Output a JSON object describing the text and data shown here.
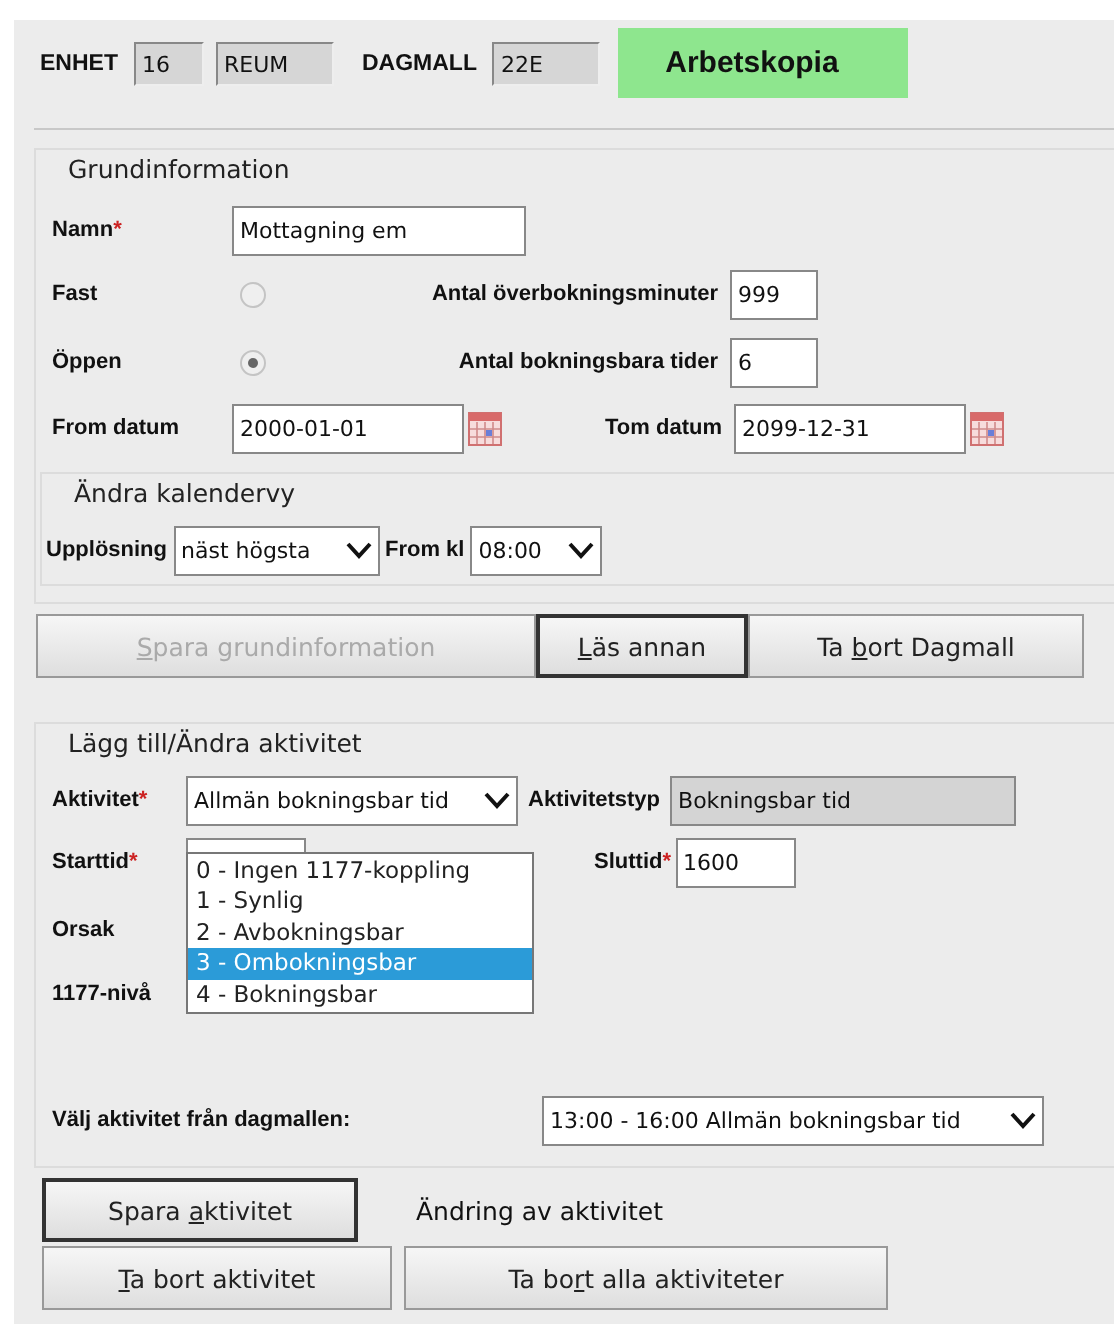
{
  "header": {
    "fields": [
      {
        "label": "ENHET",
        "values": [
          "16",
          "REUM"
        ]
      },
      {
        "label": "DAGMALL",
        "values": [
          "22E"
        ]
      }
    ],
    "status": "Arbetskopia"
  },
  "grundinformation": {
    "legend": "Grundinformation",
    "name": {
      "label": "Namn",
      "mark": "*",
      "value": "Mottagning em"
    },
    "radios": [
      {
        "label": "Fast",
        "selected": false,
        "count_label": "Antal överbokningsminuter",
        "count_value": "999"
      },
      {
        "label": "Öppen",
        "selected": true,
        "count_label": "Antal bokningsbara tider",
        "count_value": "6"
      }
    ],
    "dates": [
      {
        "label": "From datum",
        "value": "2000-01-01"
      },
      {
        "label": "Tom datum",
        "value": "2099-12-31"
      }
    ],
    "calendar_view": {
      "legend": "Ändra kalendervy",
      "selects": [
        {
          "label": "Upplösning",
          "value": "näst högsta"
        },
        {
          "label": "From kl",
          "value": "08:00"
        }
      ]
    }
  },
  "buttons": [
    {
      "label_parts": {
        "key": "S",
        "after": "para grundinformation"
      },
      "disabled": true,
      "default": false
    },
    {
      "label_parts": {
        "key": "L",
        "after": "äs annan"
      },
      "disabled": false,
      "default": true
    },
    {
      "label_parts": {
        "before": "Ta ",
        "key": "b",
        "after": "ort Dagmall"
      },
      "disabled": false,
      "default": false
    }
  ],
  "aktivitet": {
    "legend": "Lägg till/Ändra aktivitet",
    "activity": {
      "label": "Aktivitet",
      "mark": "*",
      "value": "Allmän bokningsbar tid"
    },
    "type": {
      "label": "Aktivitetstyp",
      "value": "Bokningsbar tid"
    },
    "start": {
      "label": "Starttid",
      "mark": "*"
    },
    "end": {
      "label": "Sluttid",
      "mark": "*",
      "value": "1600"
    },
    "orsak_label": "Orsak",
    "level_label": "1177-nivå",
    "level_options": [
      {
        "label": "0 - Ingen 1177-koppling",
        "selected": false
      },
      {
        "label": "1 - Synlig",
        "selected": false
      },
      {
        "label": "2 - Avbokningsbar",
        "selected": false
      },
      {
        "label": "3 - Ombokningsbar",
        "selected": true
      },
      {
        "label": "4 - Bokningsbar",
        "selected": false
      }
    ],
    "pick": {
      "label": "Välj aktivitet från dagmallen:",
      "value": "13:00 - 16:00 Allmän bokningsbar tid"
    }
  },
  "save_button": {
    "label_parts": {
      "before": "Spara ",
      "key": "a",
      "after": "ktivitet"
    },
    "default": true
  },
  "note": "Ändring av aktivitet",
  "bottom_buttons": [
    {
      "label_parts": {
        "key": "T",
        "after": "a bort aktivitet"
      }
    },
    {
      "label_parts": {
        "before": "Ta bo",
        "key": "r",
        "after": "t alla aktiviteter"
      }
    }
  ]
}
